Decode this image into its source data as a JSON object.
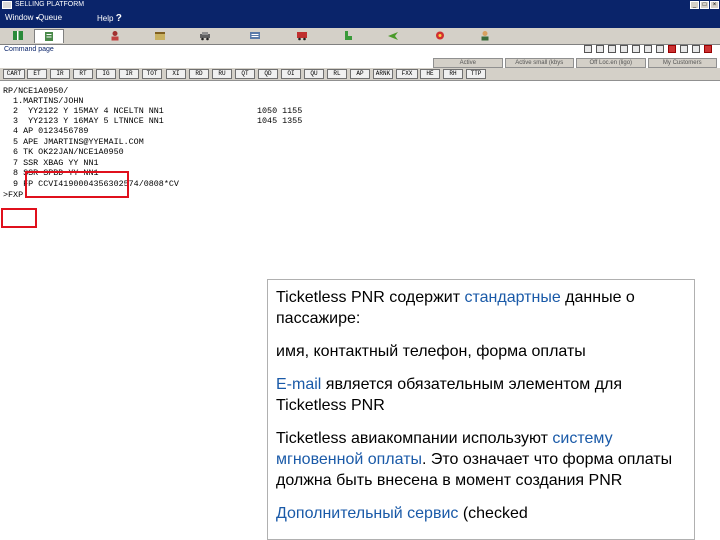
{
  "window": {
    "title": "SELLING PLATFORM",
    "buttons": [
      "_",
      "□",
      "×"
    ]
  },
  "menu": {
    "window": "Window",
    "caret": "▾",
    "queues": "Queue",
    "help": "Help",
    "help_mark": "?"
  },
  "toolbar": {
    "icons": [
      "book-icon",
      "document-icon",
      "person-icon",
      "calendar-icon",
      "car-icon",
      "list-icon",
      "bus-icon",
      "seat-icon",
      "plane-icon",
      "flower-icon",
      "profile-icon"
    ]
  },
  "command_page": {
    "label": "Command page"
  },
  "panel_tabs": [
    "Active",
    "Active small (kbys",
    "Off Loc.en (ligo)",
    "My Customers"
  ],
  "command_buttons": [
    "CART",
    "ET",
    "IR",
    "RT",
    "IG",
    "IR",
    "TOT",
    "XI",
    "RD",
    "RU",
    "QT",
    "QD",
    "OI",
    "QU",
    "RL",
    "AP",
    "ARNK",
    "FXX",
    "HE",
    "RH",
    "TTP"
  ],
  "terminal": {
    "lines": [
      {
        "segments": [
          "RP/NCE1A0950/"
        ]
      },
      {
        "segments": [
          "  1.MARTINS/JOHN"
        ]
      },
      {
        "segments": [
          "  2  YY2122 Y 15MAY 4 NCELTN NN1",
          "1050 1155"
        ]
      },
      {
        "segments": [
          "  3  YY2123 Y 16MAY 5 LTNNCE NN1",
          "1045 1355"
        ]
      },
      {
        "segments": [
          "  4 AP 0123456789"
        ]
      },
      {
        "segments": [
          "  5 APE JMARTINS@YYEMAIL.COM"
        ]
      },
      {
        "segments": [
          "  6 TK OK22JAN/NCE1A0950"
        ]
      },
      {
        "segments": [
          "  7 SSR XBAG YY NN1"
        ]
      },
      {
        "segments": [
          "  8 SSR SPBD YY NN1"
        ]
      },
      {
        "segments": [
          "  9 FP CCVI4190004356302574/0808*CV"
        ]
      },
      {
        "segments": [
          ">FXP"
        ]
      }
    ]
  },
  "info_box": {
    "paragraphs": [
      [
        {
          "text": "Ticketless PNR содержит ",
          "accent": false
        },
        {
          "text": "стандартные",
          "accent": true
        },
        {
          "text": " данные о пассажире:",
          "accent": false
        }
      ],
      [
        {
          "text": "имя, контактный телефон, форма оплаты",
          "accent": false
        }
      ],
      [
        {
          "text": "E-mail",
          "accent": true
        },
        {
          "text": " является обязательным элементом для Ticketless PNR",
          "accent": false
        }
      ],
      [
        {
          "text": "Ticketless авиакомпании используют ",
          "accent": false
        },
        {
          "text": "систему мгновенной оплаты",
          "accent": true
        },
        {
          "text": ". Это означает что форма оплаты должна быть внесена в момент создания PNR",
          "accent": false
        }
      ],
      [
        {
          "text": "Дополнительный сервис",
          "accent": true
        },
        {
          "text": " (checked",
          "accent": false
        }
      ]
    ]
  },
  "colors": {
    "titlebar": "#0a246a",
    "chrome": "#d4d0c8",
    "highlight": "#e0101c",
    "accent_text": "#1a5aa8"
  }
}
